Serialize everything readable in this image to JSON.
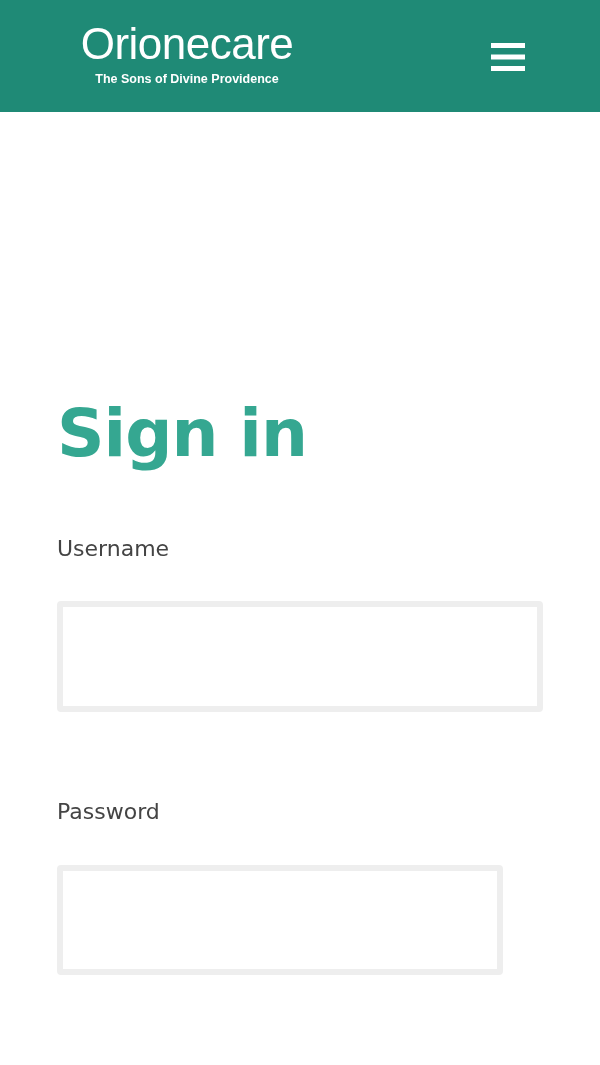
{
  "header": {
    "logo": "Orionecare",
    "tagline": "The Sons of Divine Providence"
  },
  "heading": "Sign in",
  "fields": [
    {
      "label": "Username"
    },
    {
      "label": "Password"
    }
  ]
}
